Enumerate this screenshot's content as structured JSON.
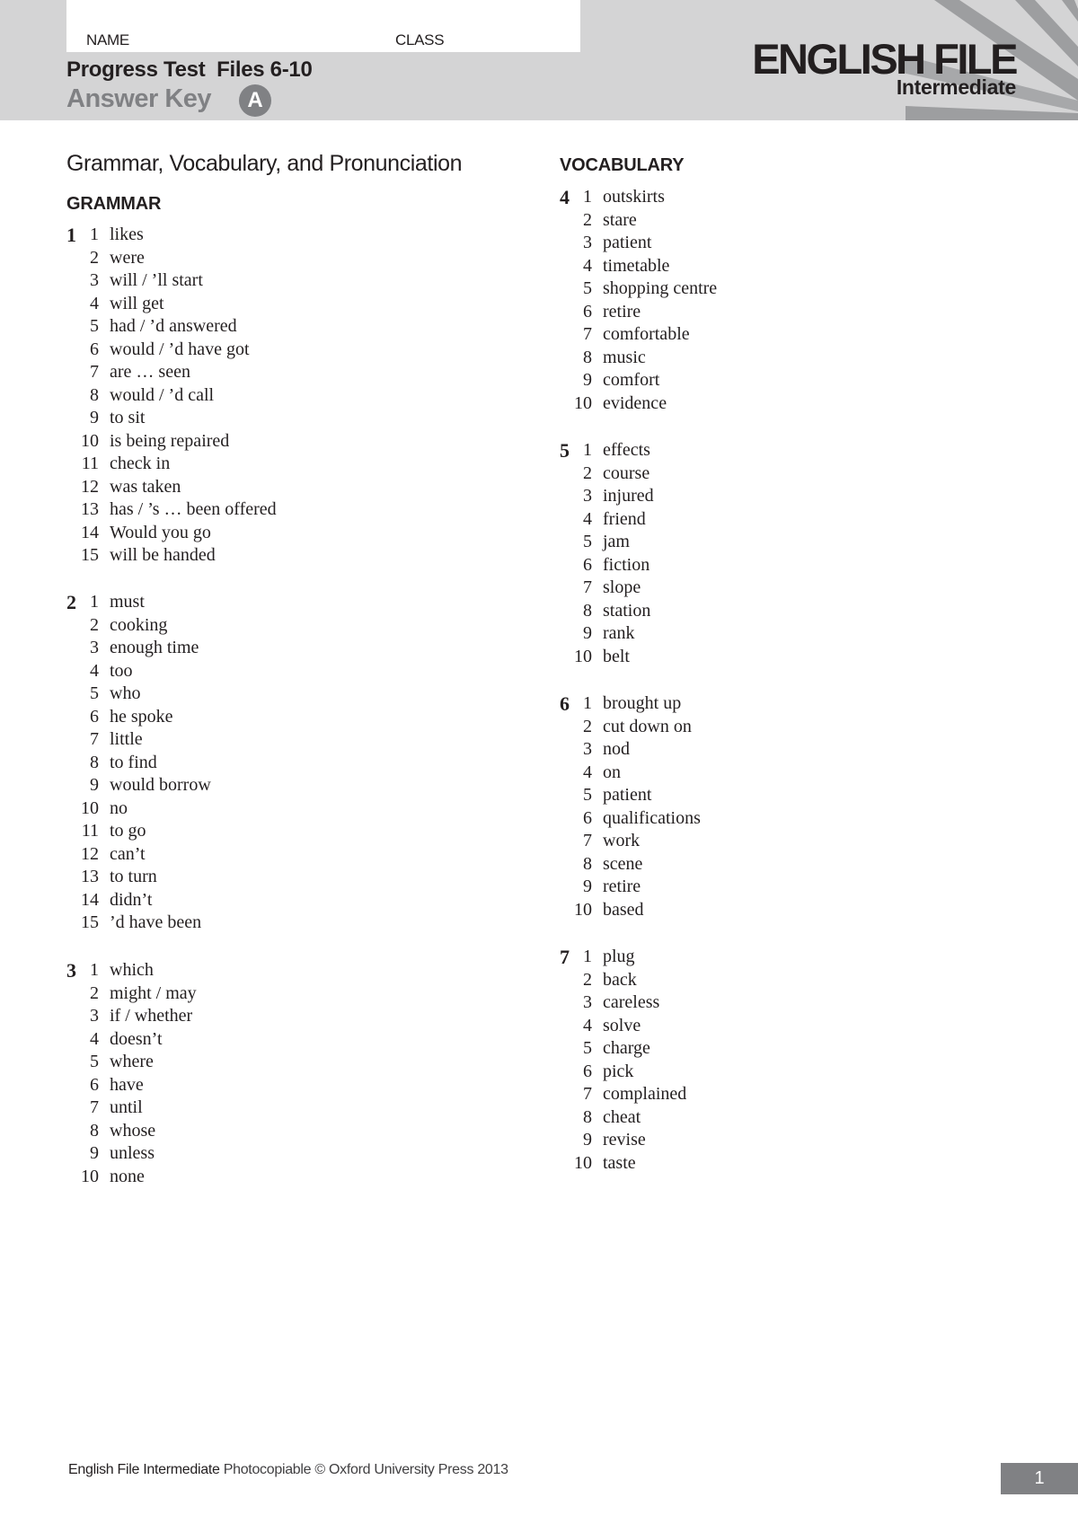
{
  "header": {
    "name_label": "NAME",
    "class_label": "CLASS",
    "test_title": "Progress Test  Files 6-10",
    "answer_key_label": "Answer Key",
    "version": "A",
    "logo_title": "ENGLISH FILE",
    "logo_level": "Intermediate",
    "colors": {
      "band": "#d4d4d5",
      "accent_gray": "#808184",
      "ray_gray": "#9d9ea0"
    }
  },
  "main": {
    "section_title": "Grammar, Vocabulary, and Pronunciation",
    "grammar_heading": "GRAMMAR",
    "vocabulary_heading": "VOCABULARY",
    "exercises": [
      {
        "number": "1",
        "items": [
          {
            "n": "1",
            "answer": "likes"
          },
          {
            "n": "2",
            "answer": "were"
          },
          {
            "n": "3",
            "answer": "will / ’ll start"
          },
          {
            "n": "4",
            "answer": "will get"
          },
          {
            "n": "5",
            "answer": "had / ’d answered"
          },
          {
            "n": "6",
            "answer": "would / ’d have got"
          },
          {
            "n": "7",
            "answer": "are … seen"
          },
          {
            "n": "8",
            "answer": "would / ’d call"
          },
          {
            "n": "9",
            "answer": "to sit"
          },
          {
            "n": "10",
            "answer": "is being repaired"
          },
          {
            "n": "11",
            "answer": "check in"
          },
          {
            "n": "12",
            "answer": "was taken"
          },
          {
            "n": "13",
            "answer": "has / ’s … been offered"
          },
          {
            "n": "14",
            "answer": "Would you go"
          },
          {
            "n": "15",
            "answer": "will be handed"
          }
        ]
      },
      {
        "number": "2",
        "items": [
          {
            "n": "1",
            "answer": "must"
          },
          {
            "n": "2",
            "answer": "cooking"
          },
          {
            "n": "3",
            "answer": "enough time"
          },
          {
            "n": "4",
            "answer": "too"
          },
          {
            "n": "5",
            "answer": "who"
          },
          {
            "n": "6",
            "answer": "he spoke"
          },
          {
            "n": "7",
            "answer": "little"
          },
          {
            "n": "8",
            "answer": "to find"
          },
          {
            "n": "9",
            "answer": "would borrow"
          },
          {
            "n": "10",
            "answer": "no"
          },
          {
            "n": "11",
            "answer": "to go"
          },
          {
            "n": "12",
            "answer": "can’t"
          },
          {
            "n": "13",
            "answer": "to turn"
          },
          {
            "n": "14",
            "answer": "didn’t"
          },
          {
            "n": "15",
            "answer": "’d have been"
          }
        ]
      },
      {
        "number": "3",
        "items": [
          {
            "n": "1",
            "answer": "which"
          },
          {
            "n": "2",
            "answer": "might / may"
          },
          {
            "n": "3",
            "answer": "if / whether"
          },
          {
            "n": "4",
            "answer": "doesn’t"
          },
          {
            "n": "5",
            "answer": "where"
          },
          {
            "n": "6",
            "answer": "have"
          },
          {
            "n": "7",
            "answer": "until"
          },
          {
            "n": "8",
            "answer": "whose"
          },
          {
            "n": "9",
            "answer": "unless"
          },
          {
            "n": "10",
            "answer": "none"
          }
        ]
      },
      {
        "number": "4",
        "items": [
          {
            "n": "1",
            "answer": "outskirts"
          },
          {
            "n": "2",
            "answer": "stare"
          },
          {
            "n": "3",
            "answer": "patient"
          },
          {
            "n": "4",
            "answer": "timetable"
          },
          {
            "n": "5",
            "answer": "shopping centre"
          },
          {
            "n": "6",
            "answer": "retire"
          },
          {
            "n": "7",
            "answer": "comfortable"
          },
          {
            "n": "8",
            "answer": "music"
          },
          {
            "n": "9",
            "answer": "comfort"
          },
          {
            "n": "10",
            "answer": "evidence"
          }
        ]
      },
      {
        "number": "5",
        "items": [
          {
            "n": "1",
            "answer": "effects"
          },
          {
            "n": "2",
            "answer": "course"
          },
          {
            "n": "3",
            "answer": "injured"
          },
          {
            "n": "4",
            "answer": "friend"
          },
          {
            "n": "5",
            "answer": "jam"
          },
          {
            "n": "6",
            "answer": "fiction"
          },
          {
            "n": "7",
            "answer": "slope"
          },
          {
            "n": "8",
            "answer": "station"
          },
          {
            "n": "9",
            "answer": "rank"
          },
          {
            "n": "10",
            "answer": "belt"
          }
        ]
      },
      {
        "number": "6",
        "items": [
          {
            "n": "1",
            "answer": "brought up"
          },
          {
            "n": "2",
            "answer": "cut down on"
          },
          {
            "n": "3",
            "answer": "nod"
          },
          {
            "n": "4",
            "answer": "on"
          },
          {
            "n": "5",
            "answer": "patient"
          },
          {
            "n": "6",
            "answer": "qualifications"
          },
          {
            "n": "7",
            "answer": "work"
          },
          {
            "n": "8",
            "answer": "scene"
          },
          {
            "n": "9",
            "answer": "retire"
          },
          {
            "n": "10",
            "answer": "based"
          }
        ]
      },
      {
        "number": "7",
        "items": [
          {
            "n": "1",
            "answer": "plug"
          },
          {
            "n": "2",
            "answer": "back"
          },
          {
            "n": "3",
            "answer": "careless"
          },
          {
            "n": "4",
            "answer": "solve"
          },
          {
            "n": "5",
            "answer": "charge"
          },
          {
            "n": "6",
            "answer": "pick"
          },
          {
            "n": "7",
            "answer": "complained"
          },
          {
            "n": "8",
            "answer": "cheat"
          },
          {
            "n": "9",
            "answer": "revise"
          },
          {
            "n": "10",
            "answer": "taste"
          }
        ]
      }
    ]
  },
  "footer": {
    "brand": "English File Intermediate",
    "copyright": " Photocopiable © Oxford University Press 2013",
    "page_number": "1"
  }
}
